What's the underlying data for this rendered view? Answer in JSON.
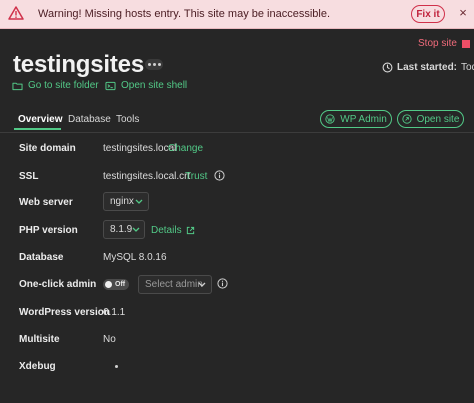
{
  "warning": {
    "message": "Warning! Missing hosts entry. This site may be inaccessible.",
    "fix_label": "Fix it",
    "close_glyph": "×",
    "icon": "warning-triangle-icon"
  },
  "header": {
    "stop_label": "Stop site",
    "site_name": "testingsites",
    "more_icon": "ellipsis-icon",
    "last_started_label": "Last started:",
    "last_started_value": "Today",
    "folder_link": "Go to site folder",
    "shell_link": "Open site shell"
  },
  "tabs": [
    {
      "label": "Overview",
      "active": true
    },
    {
      "label": "Database",
      "active": false
    },
    {
      "label": "Tools",
      "active": false
    }
  ],
  "actions": {
    "wp_admin": "WP Admin",
    "open_site": "Open site"
  },
  "details": {
    "site_domain": {
      "label": "Site domain",
      "value": "testingsites.local",
      "action": "Change"
    },
    "ssl": {
      "label": "SSL",
      "value": "testingsites.local.crt",
      "action": "Trust"
    },
    "web_server": {
      "label": "Web server",
      "value": "nginx"
    },
    "php_version": {
      "label": "PHP version",
      "value": "8.1.9",
      "action": "Details"
    },
    "database": {
      "label": "Database",
      "value": "MySQL 8.0.16"
    },
    "one_click_admin": {
      "label": "One-click admin",
      "toggle": "Off",
      "placeholder": "Select admin"
    },
    "wordpress_version": {
      "label": "WordPress version",
      "value": "6.1.1"
    },
    "multisite": {
      "label": "Multisite",
      "value": "No"
    },
    "xdebug": {
      "label": "Xdebug"
    }
  },
  "colors": {
    "accent": "#52c987",
    "danger": "#ee4e66",
    "background": "#262626",
    "warning_bg": "#f7dde0"
  }
}
